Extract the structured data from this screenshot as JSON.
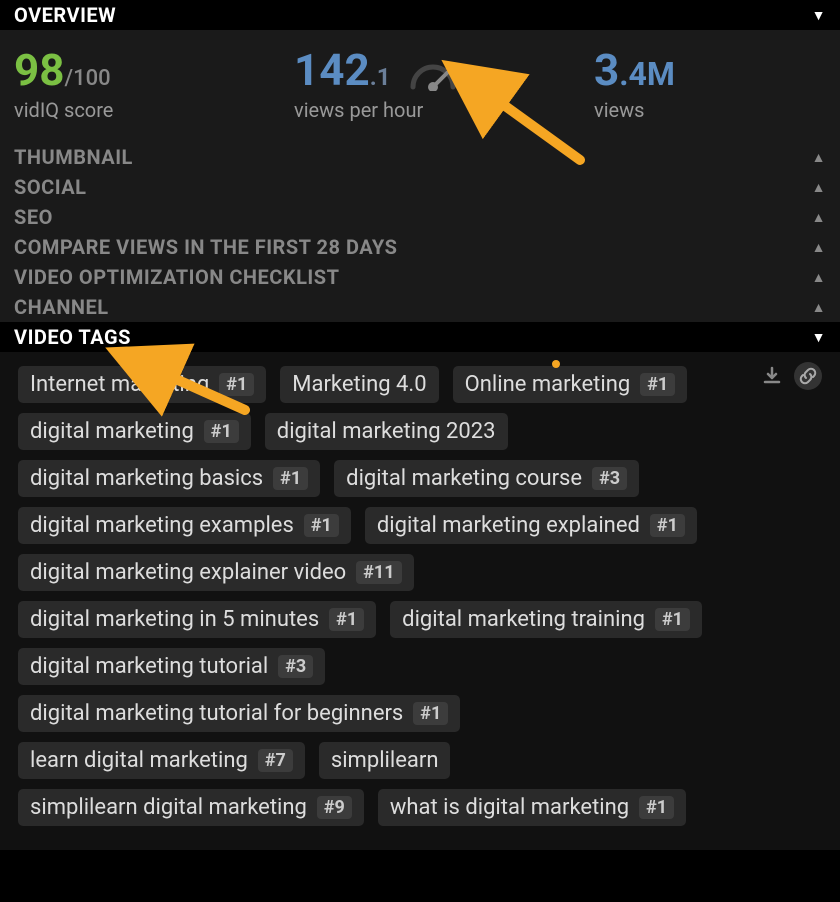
{
  "sections": {
    "overview": {
      "title": "OVERVIEW"
    },
    "thumbnail": {
      "title": "THUMBNAIL"
    },
    "social": {
      "title": "SOCIAL"
    },
    "seo": {
      "title": "SEO"
    },
    "compare": {
      "title": "COMPARE VIEWS IN THE FIRST 28 DAYS"
    },
    "checklist": {
      "title": "VIDEO OPTIMIZATION CHECKLIST"
    },
    "channel": {
      "title": "CHANNEL"
    },
    "videotags": {
      "title": "VIDEO TAGS"
    }
  },
  "overview": {
    "score": {
      "value": "98",
      "suffix": "/100",
      "label": "vidIQ score"
    },
    "vph": {
      "value": "142",
      "suffix": ".1",
      "label": "views per hour"
    },
    "views": {
      "value": "3",
      "suffix": ".4M",
      "label": "views"
    }
  },
  "tags": [
    {
      "text": "Internet marketing",
      "rank": "#1"
    },
    {
      "text": "Marketing 4.0",
      "rank": null
    },
    {
      "text": "Online marketing",
      "rank": "#1"
    },
    {
      "text": "digital marketing",
      "rank": "#1"
    },
    {
      "text": "digital marketing 2023",
      "rank": null
    },
    {
      "text": "digital marketing basics",
      "rank": "#1"
    },
    {
      "text": "digital marketing course",
      "rank": "#3"
    },
    {
      "text": "digital marketing examples",
      "rank": "#1"
    },
    {
      "text": "digital marketing explained",
      "rank": "#1"
    },
    {
      "text": "digital marketing explainer video",
      "rank": "#11"
    },
    {
      "text": "digital marketing in 5 minutes",
      "rank": "#1"
    },
    {
      "text": "digital marketing training",
      "rank": "#1"
    },
    {
      "text": "digital marketing tutorial",
      "rank": "#3"
    },
    {
      "text": "digital marketing tutorial for beginners",
      "rank": "#1"
    },
    {
      "text": "learn digital marketing",
      "rank": "#7"
    },
    {
      "text": "simplilearn",
      "rank": null
    },
    {
      "text": "simplilearn digital marketing",
      "rank": "#9"
    },
    {
      "text": "what is digital marketing",
      "rank": "#1"
    }
  ]
}
